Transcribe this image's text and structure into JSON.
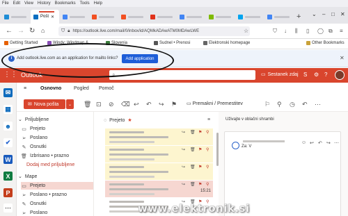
{
  "browser": {
    "menu": [
      "File",
      "Edit",
      "View",
      "History",
      "Bookmarks",
      "Tools",
      "Help"
    ],
    "tabs": [
      {
        "favicon": "edge-icon",
        "color": "#1f8dd6",
        "active": false
      },
      {
        "favicon": "outlook-icon",
        "color": "#0b6ec1",
        "active": true,
        "title": "Pošt",
        "close": "✕"
      },
      {
        "favicon": "google-icon",
        "color": "#4285f4",
        "active": false
      },
      {
        "favicon": "microsoft-icon",
        "color": "#f25022",
        "active": false
      },
      {
        "favicon": "microsoft-icon",
        "color": "#f25022",
        "active": false
      },
      {
        "favicon": "opera-icon",
        "color": "#e0321b",
        "active": false
      },
      {
        "favicon": "google-icon",
        "color": "#4285f4",
        "active": false
      },
      {
        "favicon": "microsoft-icon",
        "color": "#7fba00",
        "active": false
      },
      {
        "favicon": "microsoft-icon",
        "color": "#00a4ef",
        "active": false
      },
      {
        "favicon": "google-icon",
        "color": "#4285f4",
        "active": false
      }
    ],
    "url": "https://outlook.live.com/mail/0/inbox/id/AQMkADAwATM0MDAwLWE",
    "bookmarks": [
      {
        "label": "Getting Started"
      },
      {
        "label": "Windy: Windmap &..."
      },
      {
        "label": "Slovenia"
      },
      {
        "label": "Sudnel • Prenosi"
      },
      {
        "label": "Elektronski homepage"
      },
      {
        "label": "Other Bookmarks"
      }
    ]
  },
  "infobar": {
    "message": "Add outlook.live.com as an application for mailto links?",
    "button": "Add application",
    "close": "✕"
  },
  "outlook": {
    "brand": "Outlook",
    "meet_now": "Sestanek zdaj",
    "ribbon_tabs": [
      "Osnovno",
      "Pogled",
      "Pomoč"
    ],
    "new_mail": "Nova pošta",
    "move_to": "Premakni / Premestitev",
    "favorites_group": "Priljubljene",
    "favorites": [
      {
        "icon": "inbox-icon",
        "label": "Prejeto"
      },
      {
        "icon": "sent-icon",
        "label": "Poslano"
      },
      {
        "icon": "drafts-icon",
        "label": "Osnutki"
      },
      {
        "icon": "deleted-icon",
        "label": "Izbrisano • prazno"
      }
    ],
    "add_favorite": "Dodaj med priljubljene",
    "folders_group": "Mape",
    "folders": [
      {
        "icon": "inbox-icon",
        "label": "Prejeto",
        "selected": true
      },
      {
        "icon": "sent-icon",
        "label": "Poslano • prazno",
        "selected": false
      },
      {
        "icon": "drafts-icon",
        "label": "Osnutki",
        "selected": false
      },
      {
        "icon": "sent-icon",
        "label": "Poslano",
        "selected": false
      }
    ],
    "list_title": "Prejeto",
    "message_rows": [
      {
        "bg": "yellow",
        "time": ""
      },
      {
        "bg": "yellow",
        "time": ""
      },
      {
        "bg": "yellow",
        "time": ""
      },
      {
        "bg": "red",
        "time": "15:21"
      },
      {
        "bg": "white",
        "time": ""
      }
    ],
    "reading_subject": "Uživajte v oblačni shrambi",
    "reading_to": "Za: V"
  },
  "watermark": "www.elektronik.si",
  "colors": {
    "outlook_accent": "#d9452d",
    "firefox_blue": "#1d5dd8"
  }
}
